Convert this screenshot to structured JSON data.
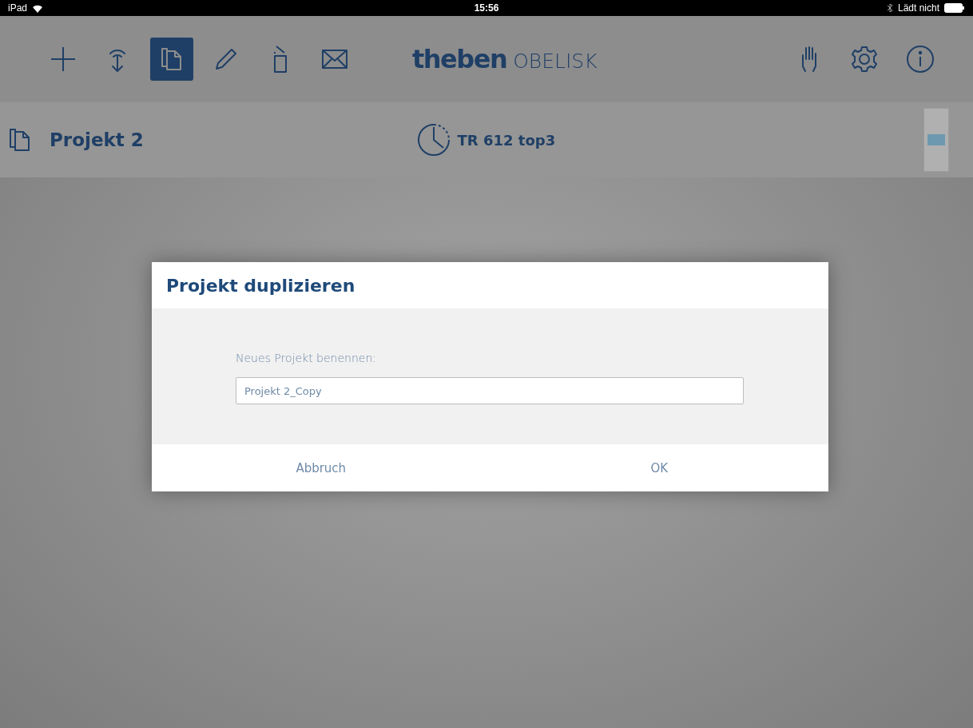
{
  "status_bar": {
    "device": "iPad",
    "time": "15:56",
    "battery_text": "Lädt nicht"
  },
  "toolbar": {
    "tools": [
      {
        "kind": "plus",
        "selected": false
      },
      {
        "kind": "transfer",
        "selected": false
      },
      {
        "kind": "copy",
        "selected": true
      },
      {
        "kind": "pencil",
        "selected": false
      },
      {
        "kind": "bin",
        "selected": false
      },
      {
        "kind": "mail",
        "selected": false
      }
    ],
    "logo": {
      "brand": "theben",
      "product": "OBELISK"
    },
    "right_tools": [
      {
        "kind": "hand"
      },
      {
        "kind": "gear"
      },
      {
        "kind": "info"
      }
    ]
  },
  "project_bar": {
    "project": "Projekt 2",
    "device": "TR 612 top3"
  },
  "dialog": {
    "title": "Projekt duplizieren",
    "label": "Neues Projekt benennen:",
    "value": "Projekt 2_Copy",
    "buttons": [
      "Abbruch",
      "OK"
    ]
  }
}
